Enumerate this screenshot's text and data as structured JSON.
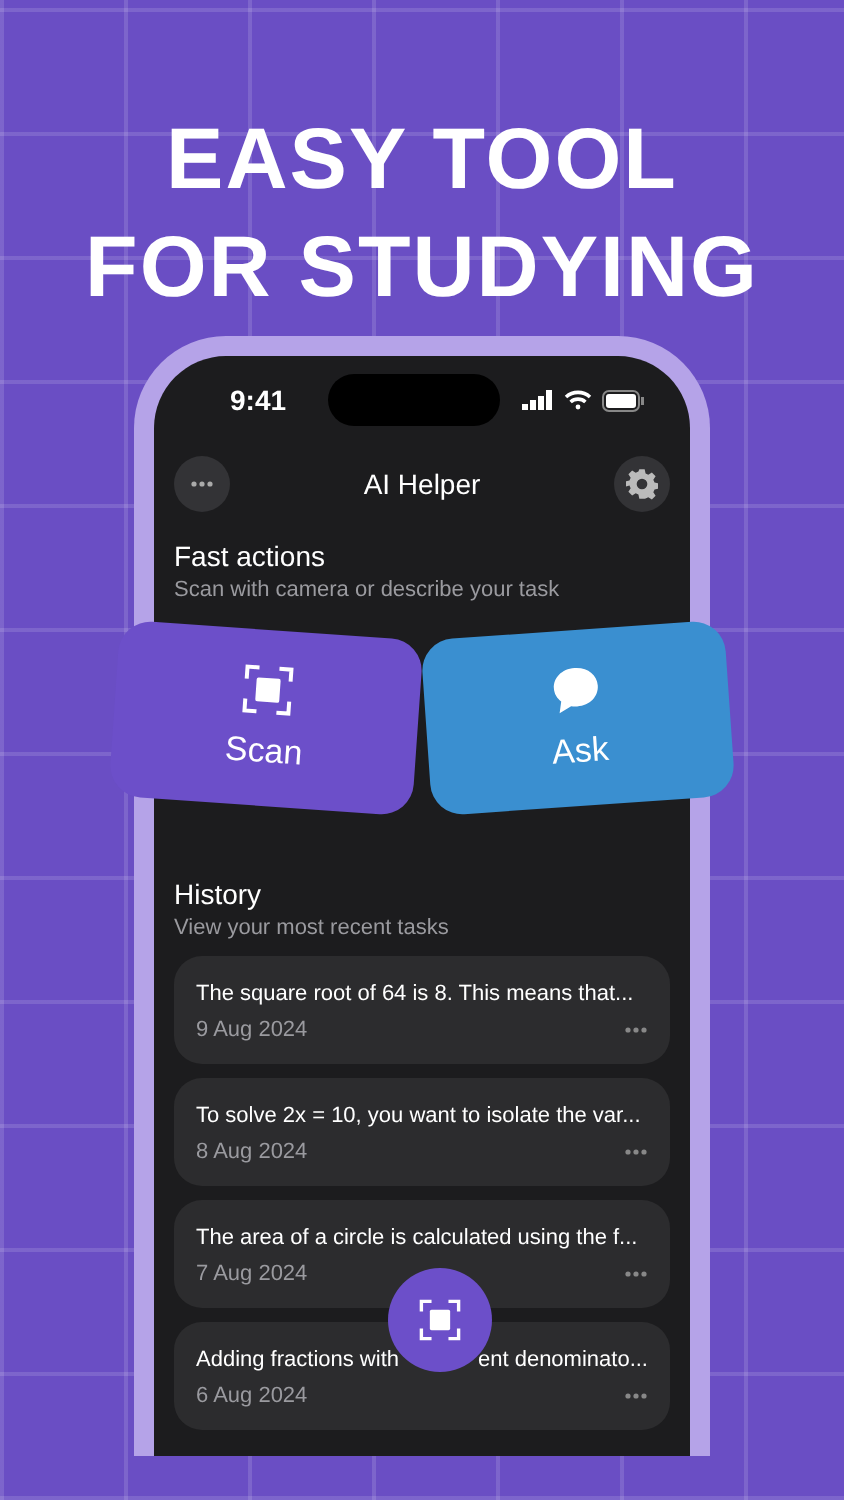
{
  "headline": [
    "EASY TOOL",
    "FOR STUDYING"
  ],
  "status_bar": {
    "time": "9:41"
  },
  "nav": {
    "title": "AI Helper"
  },
  "fast_actions": {
    "title": "Fast actions",
    "subtitle": "Scan with camera or describe your task",
    "actions": [
      {
        "kind": "scan",
        "label": "Scan",
        "color": "#6c4fc9"
      },
      {
        "kind": "ask",
        "label": "Ask",
        "color": "#3a8fd0"
      }
    ]
  },
  "history": {
    "title": "History",
    "subtitle": "View your most recent tasks",
    "items": [
      {
        "title": "The square root of 64 is 8. This means that...",
        "date": "9 Aug 2024"
      },
      {
        "title": "To solve 2x = 10, you want to isolate the var...",
        "date": "8 Aug 2024"
      },
      {
        "title": "The area of a circle is calculated using the f...",
        "date": "7 Aug 2024"
      },
      {
        "title": "Adding fractions with",
        "title_tail": "ent denominato...",
        "date": "6 Aug 2024"
      }
    ]
  }
}
